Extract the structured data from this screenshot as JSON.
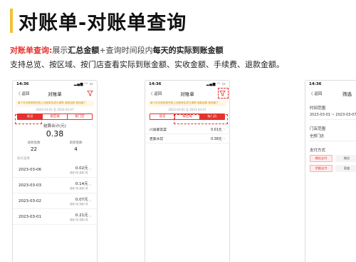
{
  "title": "对账单-对账单查询",
  "desc1": {
    "lead": "对账单查询:",
    "p1": "展示",
    "b1": "汇总金额",
    "p2": "+查询时间段内",
    "b2": "每天的实际到账金额"
  },
  "desc2": "支持总览、按区域、按门店查看实际到账金额、实收金额、手续费、退款金额。",
  "phone1": {
    "status_time": "14:36",
    "status_icons": "▂▄▆ ◠ ▭",
    "back": "〈 返回",
    "title": "对账单",
    "notice": "每个月月底前将完成上月账单生成与清算 收款结算 我知道了",
    "date_range": "2023-03-01 至 2023-03-07",
    "tabs": [
      "总览",
      "按区域",
      "按门店"
    ],
    "summary_label": "结算合计(元)",
    "summary_value": "0.38",
    "stats": [
      {
        "label": "收款笔数",
        "value": "22"
      },
      {
        "label": "退款笔数",
        "value": "4"
      }
    ],
    "section": "按日查看",
    "rows": [
      {
        "date": "2023-03-06",
        "amount": "0.02元",
        "sub": "退款1笔 退款1笔"
      },
      {
        "date": "2023-03-03",
        "amount": "0.14元",
        "sub": "退款1笔 退款1笔"
      },
      {
        "date": "2023-03-02",
        "amount": "0.07元",
        "sub": "退款1笔 退款1笔"
      },
      {
        "date": "2023-03-01",
        "amount": "0.21元",
        "sub": "退款1笔 退款1笔"
      }
    ]
  },
  "phone2": {
    "status_time": "14:36",
    "status_icons": "▂▄▆ ◠ ▭",
    "back": "〈 返回",
    "title": "对账单",
    "notice": "每个月月底前将完成上月账单生成与清算 收款结算 我知道了",
    "date_range": "2023-03-01 至 2023-03-07",
    "tabs": [
      "总览",
      "按区域",
      "按门店"
    ],
    "rows": [
      {
        "name": "川渝家常菜",
        "amount": "0.01元"
      },
      {
        "name": "老家水饺",
        "amount": "0.38元"
      }
    ]
  },
  "phone3": {
    "status_time": "14:36",
    "back": "〈 返回",
    "title": "筛选",
    "time_label": "时间范围",
    "time_value": "2023-03-01 ~ 2023-03-07",
    "store_label": "门店范围",
    "store_value": "全部门店",
    "pay_label": "支付方式",
    "chips": [
      "微信支付",
      "微信",
      "余额支付",
      "银盛"
    ]
  }
}
